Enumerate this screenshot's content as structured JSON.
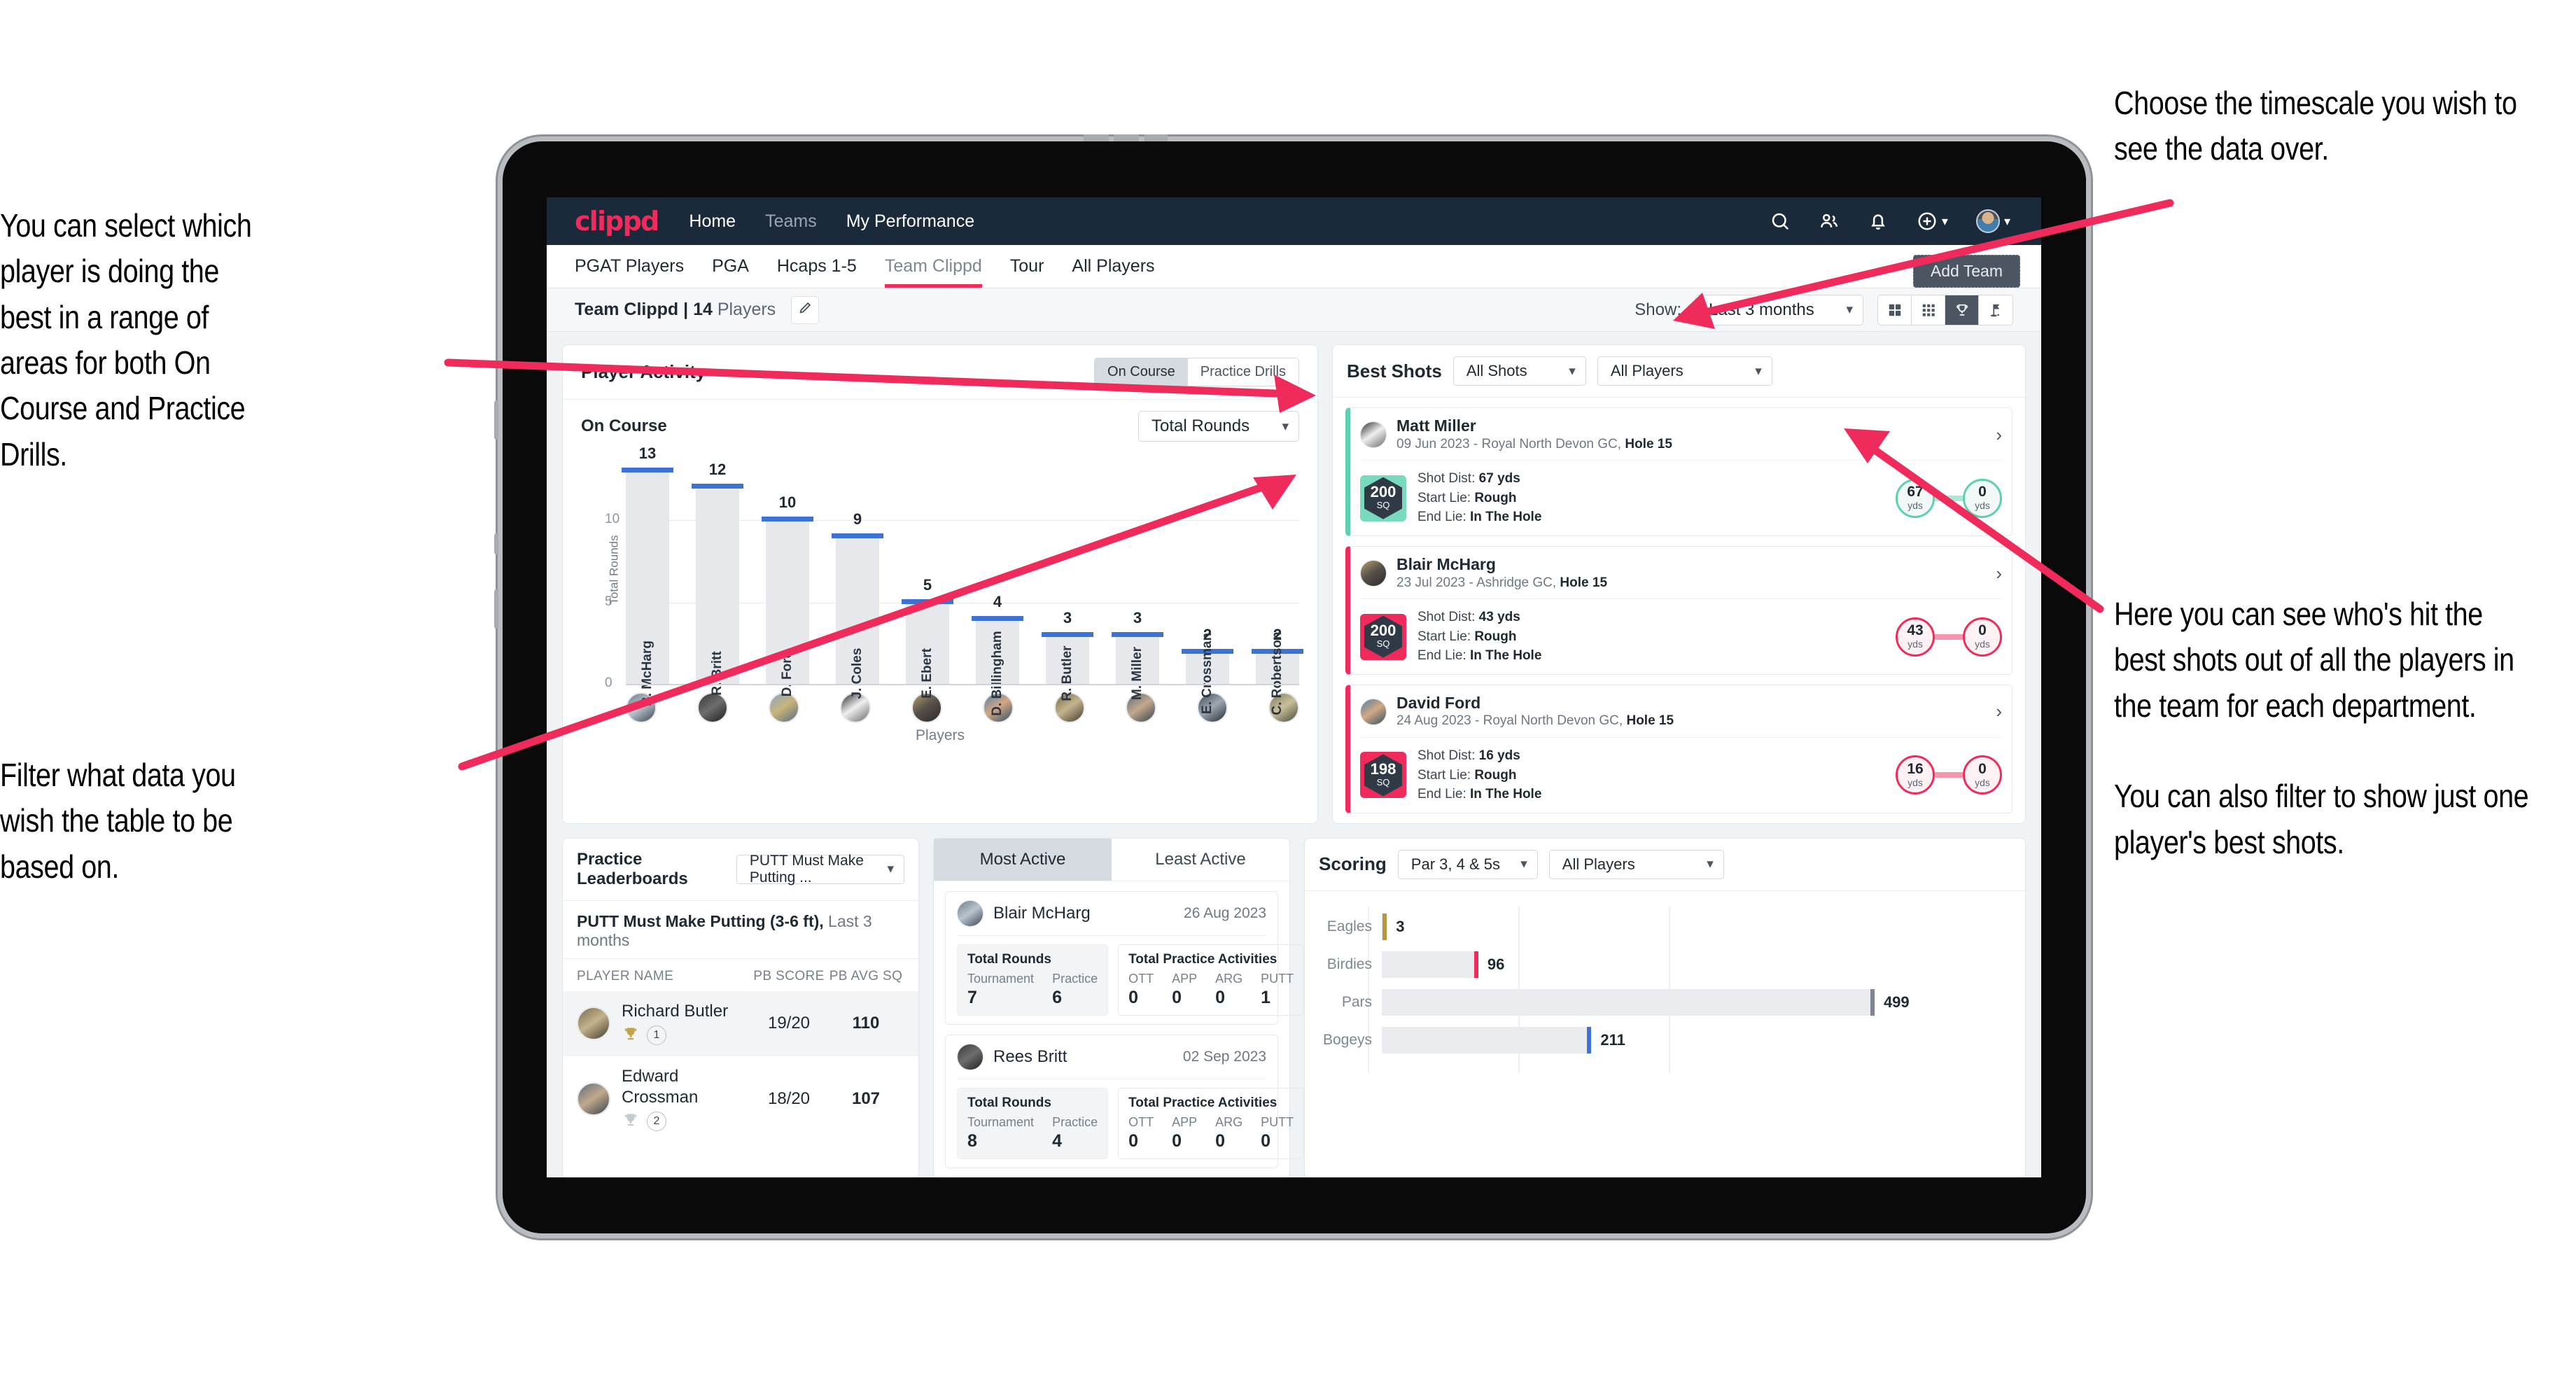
{
  "annotations": {
    "left_top": "You can select which player is doing the best in a range of areas for both On Course and Practice Drills.",
    "left_bottom": "Filter what data you wish the table to be based on.",
    "right_top": "Choose the timescale you wish to see the data over.",
    "right_mid": "Here you can see who's hit the best shots out of all the players in the team for each department.",
    "right_bottom": "You can also filter to show just one player's best shots."
  },
  "app": {
    "logo": "clippd",
    "nav": [
      {
        "label": "Home",
        "dim": false
      },
      {
        "label": "Teams",
        "dim": true
      },
      {
        "label": "My Performance",
        "dim": false
      }
    ],
    "header_icons": [
      "search-icon",
      "people-icon",
      "bell-icon",
      "plus-circle-icon",
      "avatar"
    ],
    "tabs": [
      {
        "label": "PGAT Players",
        "active": false
      },
      {
        "label": "PGA",
        "active": false
      },
      {
        "label": "Hcaps 1-5",
        "active": false
      },
      {
        "label": "Team Clippd",
        "active": true
      },
      {
        "label": "Tour",
        "active": false
      },
      {
        "label": "All Players",
        "active": false
      }
    ],
    "add_team_button": "Add Team"
  },
  "toolbar": {
    "team_name": "Team Clippd",
    "separator": " | ",
    "player_count": "14",
    "players_word": " Players",
    "edit_icon": "pencil-icon",
    "show_label": "Show:",
    "timescale_value": "Last 3 months",
    "view_icons": [
      "grid-large-icon",
      "grid-small-icon",
      "trophy-icon",
      "flag-icon"
    ],
    "active_view": "trophy-icon"
  },
  "player_activity": {
    "title": "Player Activity",
    "segments": [
      {
        "label": "On Course",
        "active": true
      },
      {
        "label": "Practice Drills",
        "active": false
      }
    ],
    "sub_label": "On Course",
    "metric_select": "Total Rounds"
  },
  "chart_data": [
    {
      "type": "bar",
      "title": "Player Activity",
      "xlabel": "Players",
      "ylabel": "Total Rounds",
      "ylim": [
        0,
        14
      ],
      "yticks": [
        5,
        10
      ],
      "grid": true,
      "categories": [
        "B. McHarg",
        "R. Britt",
        "D. Ford",
        "J. Coles",
        "E. Ebert",
        "D. Billingham",
        "R. Butler",
        "M. Miller",
        "E. Crossman",
        "C. Robertson"
      ],
      "values": [
        13,
        12,
        10,
        9,
        5,
        4,
        3,
        3,
        2,
        2
      ]
    },
    {
      "type": "bar",
      "title": "Scoring",
      "orientation": "horizontal",
      "categories": [
        "Eagles",
        "Birdies",
        "Pars",
        "Bogeys"
      ],
      "values": [
        3,
        96,
        499,
        211
      ],
      "colors": [
        "#b8953f",
        "#ef2b5c",
        "#7c8694",
        "#3b72d4"
      ],
      "xlim": [
        0,
        640
      ],
      "grid": true
    }
  ],
  "best_shots": {
    "title": "Best Shots",
    "shot_filter": "All Shots",
    "player_filter": "All Players",
    "shots": [
      {
        "player": "Matt Miller",
        "meta_date": "09 Jun 2023 - Royal North Devon GC, ",
        "meta_hole": "Hole 15",
        "sq_value": "200",
        "sq_unit": "SQ",
        "shot_dist_label": "Shot Dist: ",
        "shot_dist_value": "67 yds",
        "start_lie_label": "Start Lie: ",
        "start_lie_value": "Rough",
        "end_lie_label": "End Lie: ",
        "end_lie_value": "In The Hole",
        "from_value": "67",
        "from_unit": "yds",
        "to_value": "0",
        "to_unit": "yds",
        "accent": "teal"
      },
      {
        "player": "Blair McHarg",
        "meta_date": "23 Jul 2023 - Ashridge GC, ",
        "meta_hole": "Hole 15",
        "sq_value": "200",
        "sq_unit": "SQ",
        "shot_dist_label": "Shot Dist: ",
        "shot_dist_value": "43 yds",
        "start_lie_label": "Start Lie: ",
        "start_lie_value": "Rough",
        "end_lie_label": "End Lie: ",
        "end_lie_value": "In The Hole",
        "from_value": "43",
        "from_unit": "yds",
        "to_value": "0",
        "to_unit": "yds",
        "accent": "pink"
      },
      {
        "player": "David Ford",
        "meta_date": "24 Aug 2023 - Royal North Devon GC, ",
        "meta_hole": "Hole 15",
        "sq_value": "198",
        "sq_unit": "SQ",
        "shot_dist_label": "Shot Dist: ",
        "shot_dist_value": "16 yds",
        "start_lie_label": "Start Lie: ",
        "start_lie_value": "Rough",
        "end_lie_label": "End Lie: ",
        "end_lie_value": "In The Hole",
        "from_value": "16",
        "from_unit": "yds",
        "to_value": "0",
        "to_unit": "yds",
        "accent": "pink"
      }
    ]
  },
  "practice_leaderboards": {
    "title": "Practice Leaderboards",
    "drill_select": "PUTT Must Make Putting ...",
    "subtitle_bold": "PUTT Must Make Putting (3-6 ft),",
    "subtitle_muted": " Last 3 months",
    "columns": [
      "PLAYER NAME",
      "PB SCORE",
      "PB AVG SQ"
    ],
    "rows": [
      {
        "name": "Richard Butler",
        "rank": "1",
        "trophy": "gold",
        "pb_score": "19/20",
        "pb_avg_sq": "110",
        "highlighted": true
      },
      {
        "name": "Edward Crossman",
        "rank": "2",
        "trophy": "silver",
        "pb_score": "18/20",
        "pb_avg_sq": "107",
        "highlighted": false
      }
    ]
  },
  "activity": {
    "tabs": [
      {
        "label": "Most Active",
        "active": true
      },
      {
        "label": "Least Active",
        "active": false
      }
    ],
    "cards": [
      {
        "name": "Blair McHarg",
        "date": "26 Aug 2023",
        "rounds_title": "Total Rounds",
        "rounds": [
          {
            "k": "Tournament",
            "v": "7"
          },
          {
            "k": "Practice",
            "v": "6"
          }
        ],
        "practice_title": "Total Practice Activities",
        "practice": [
          {
            "k": "OTT",
            "v": "0"
          },
          {
            "k": "APP",
            "v": "0"
          },
          {
            "k": "ARG",
            "v": "0"
          },
          {
            "k": "PUTT",
            "v": "1"
          }
        ]
      },
      {
        "name": "Rees Britt",
        "date": "02 Sep 2023",
        "rounds_title": "Total Rounds",
        "rounds": [
          {
            "k": "Tournament",
            "v": "8"
          },
          {
            "k": "Practice",
            "v": "4"
          }
        ],
        "practice_title": "Total Practice Activities",
        "practice": [
          {
            "k": "OTT",
            "v": "0"
          },
          {
            "k": "APP",
            "v": "0"
          },
          {
            "k": "ARG",
            "v": "0"
          },
          {
            "k": "PUTT",
            "v": "0"
          }
        ]
      }
    ]
  },
  "scoring": {
    "title": "Scoring",
    "par_filter": "Par 3, 4 & 5s",
    "player_filter": "All Players"
  },
  "colors": {
    "brand_pink": "#ef2b5c",
    "header_navy": "#1b2a3b",
    "bar_blue": "#3b72d4",
    "teal": "#5ecfb1",
    "gold": "#b8953f"
  }
}
